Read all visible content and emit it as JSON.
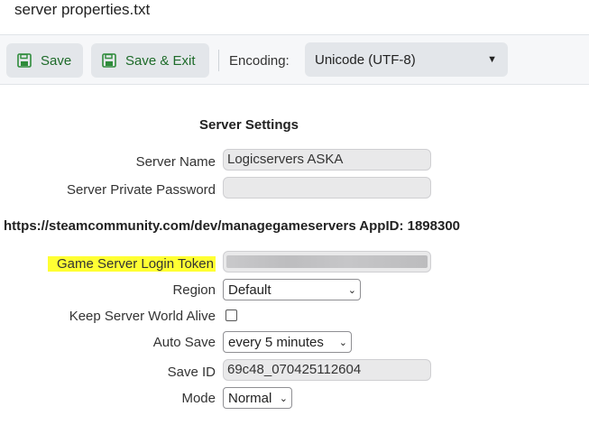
{
  "file_title": "server properties.txt",
  "toolbar": {
    "save_label": "Save",
    "save_exit_label": "Save & Exit",
    "encoding_label": "Encoding:",
    "encoding_value": "Unicode (UTF-8)",
    "icons": [
      "floppy-disk-icon",
      "chevron-down-icon"
    ],
    "accent_color": "#1e6b2a"
  },
  "settings": {
    "title": "Server Settings",
    "server_name_label": "Server Name",
    "server_name_value": "Logicservers ASKA",
    "private_password_label": "Server Private Password",
    "private_password_value": "",
    "steam_url_line": "https://steamcommunity.com/dev/managegameservers AppID: 1898300",
    "login_token_label": "Game Server Login Token",
    "login_token_highlight_color": "#ffff33",
    "region_label": "Region",
    "region_value": "Default",
    "keep_alive_label": "Keep Server World Alive",
    "keep_alive_checked": false,
    "auto_save_label": "Auto Save",
    "auto_save_value": "every 5 minutes",
    "save_id_label": "Save ID",
    "save_id_value": "69c48_070425112604",
    "mode_label": "Mode",
    "mode_value": "Normal"
  }
}
